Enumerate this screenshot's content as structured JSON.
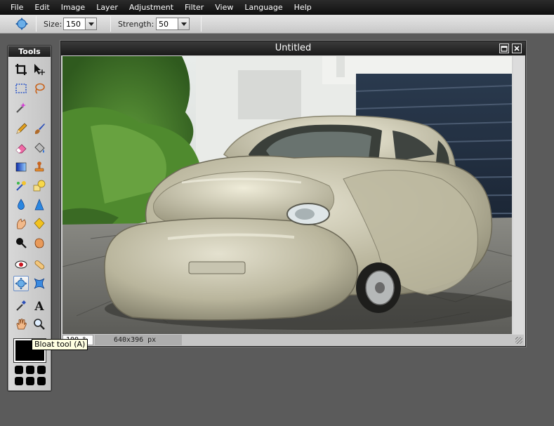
{
  "menu": [
    "File",
    "Edit",
    "Image",
    "Layer",
    "Adjustment",
    "Filter",
    "View",
    "Language",
    "Help"
  ],
  "options": {
    "size_label": "Size:",
    "size_value": "150",
    "strength_label": "Strength:",
    "strength_value": "50"
  },
  "tools": {
    "title": "Tools",
    "tooltip": "Bloat tool (A)",
    "items": [
      "crop-icon",
      "move-icon",
      "marquee-select-icon",
      "lasso-icon",
      "magic-wand-icon",
      "pencil-icon",
      "brush-icon",
      "eraser-icon",
      "paint-bucket-icon",
      "gradient-icon",
      "clone-stamp-icon",
      "color-replace-icon",
      "drawing-icon",
      "blur-icon",
      "sharpen-icon",
      "smudge-icon",
      "sponge-icon",
      "dodge-icon",
      "burn-icon",
      "red-eye-icon",
      "spot-heal-icon",
      "bloat-icon",
      "pinch-icon",
      "color-picker-icon",
      "type-icon",
      "hand-icon",
      "zoom-icon"
    ]
  },
  "document": {
    "title": "Untitled",
    "zoom": "100 %",
    "dimensions": "640x396 px"
  },
  "colors": {
    "menubar": "#1a1a1a",
    "workspace": "#5b5b5b",
    "foreground": "#000000"
  }
}
